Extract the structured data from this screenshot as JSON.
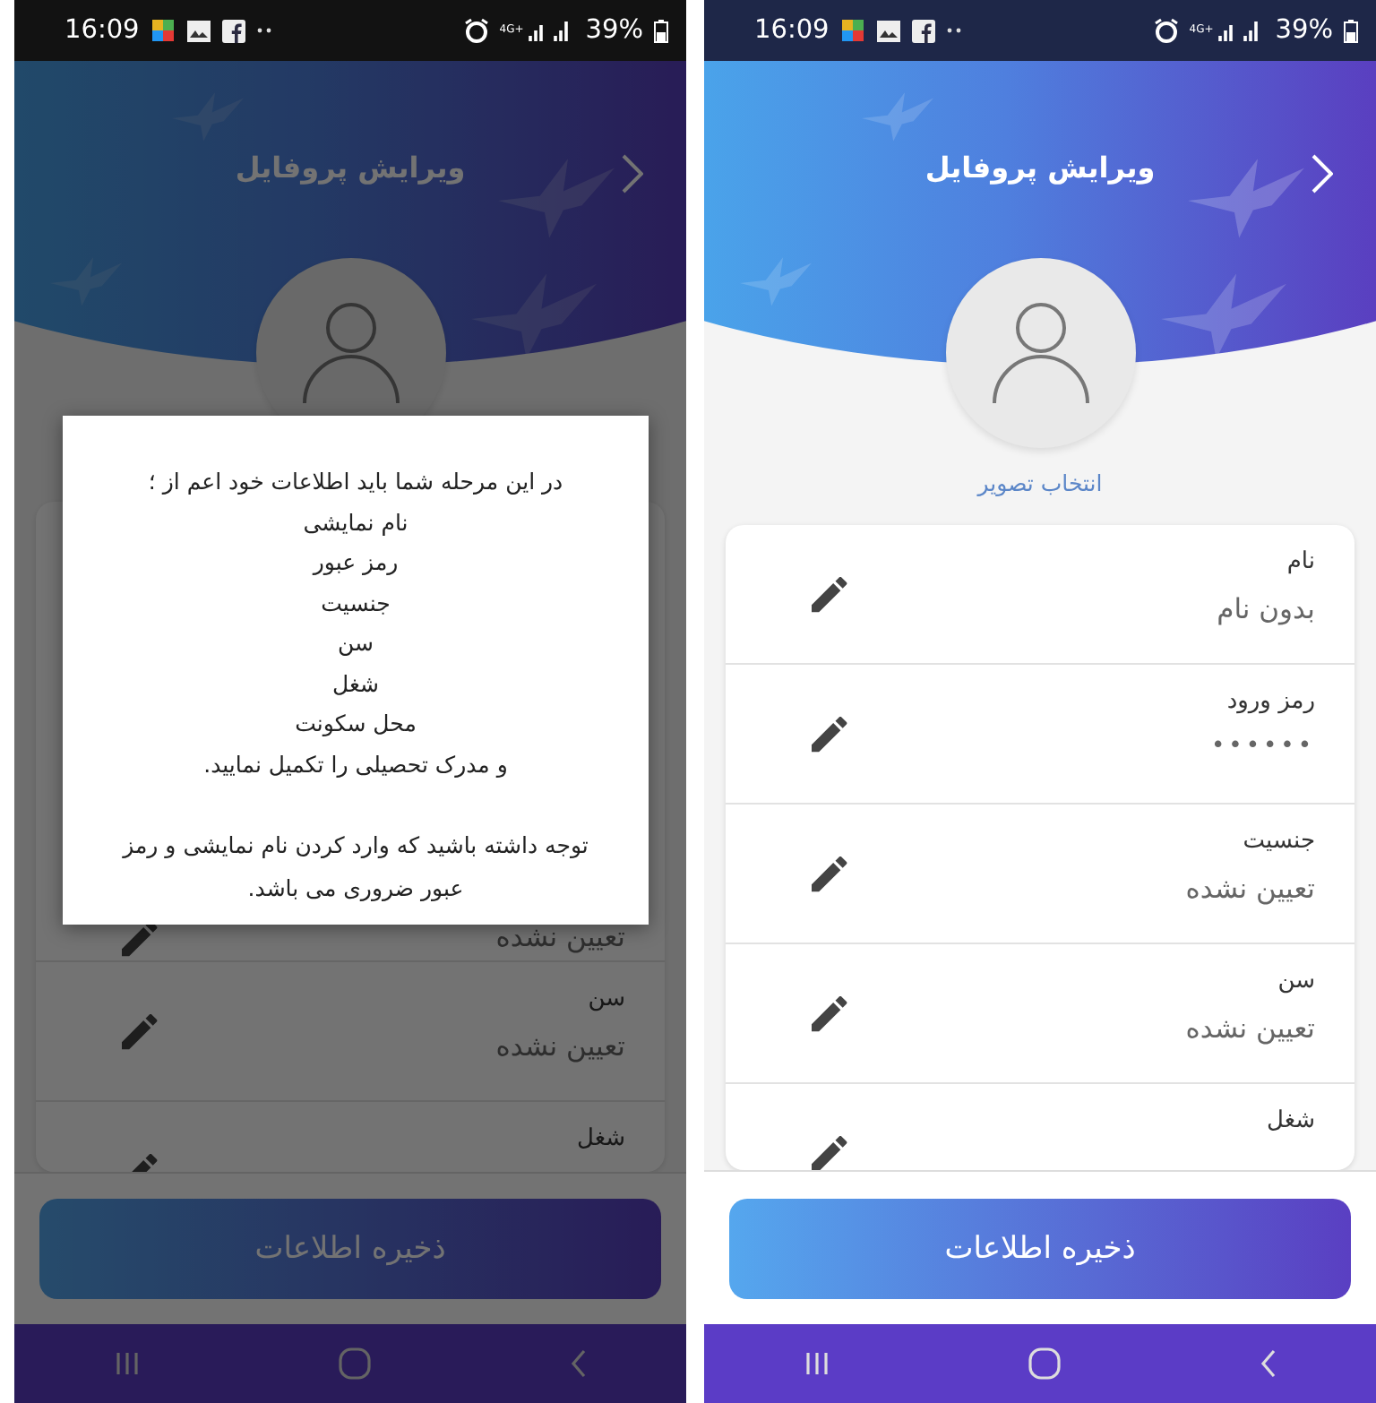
{
  "left_screen": {
    "status_bar": {
      "time": "16:09",
      "network": "4G+",
      "battery": "39%"
    },
    "header": {
      "title": "ویرایش پروفایل"
    },
    "fields": [
      {
        "value": "تعیین نشده"
      },
      {
        "label": "سن",
        "value": "تعیین نشده"
      },
      {
        "label": "شغل"
      }
    ],
    "save_button": "ذخیره اطلاعات",
    "dialog": {
      "lines": [
        "در این مرحله شما باید اطلاعات خود اعم از ؛",
        "نام نمایشی",
        "رمز عبور",
        "جنسیت",
        "سن",
        "شغل",
        "محل سکونت",
        "و مدرک تحصیلی را تکمیل نمایید."
      ],
      "note": "توجه داشته باشید که وارد کردن نام نمایشی و رمز عبور ضروری می باشد."
    }
  },
  "right_screen": {
    "status_bar": {
      "time": "16:09",
      "network": "4G+",
      "battery": "39%"
    },
    "header": {
      "title": "ویرایش پروفایل"
    },
    "photo_caption": "انتخاب تصویر",
    "fields": [
      {
        "label": "نام",
        "value": "بدون نام"
      },
      {
        "label": "رمز ورود",
        "value": "••••••"
      },
      {
        "label": "جنسیت",
        "value": "تعیین نشده"
      },
      {
        "label": "سن",
        "value": "تعیین نشده"
      },
      {
        "label": "شغل"
      }
    ],
    "save_button": "ذخیره اطلاعات"
  }
}
